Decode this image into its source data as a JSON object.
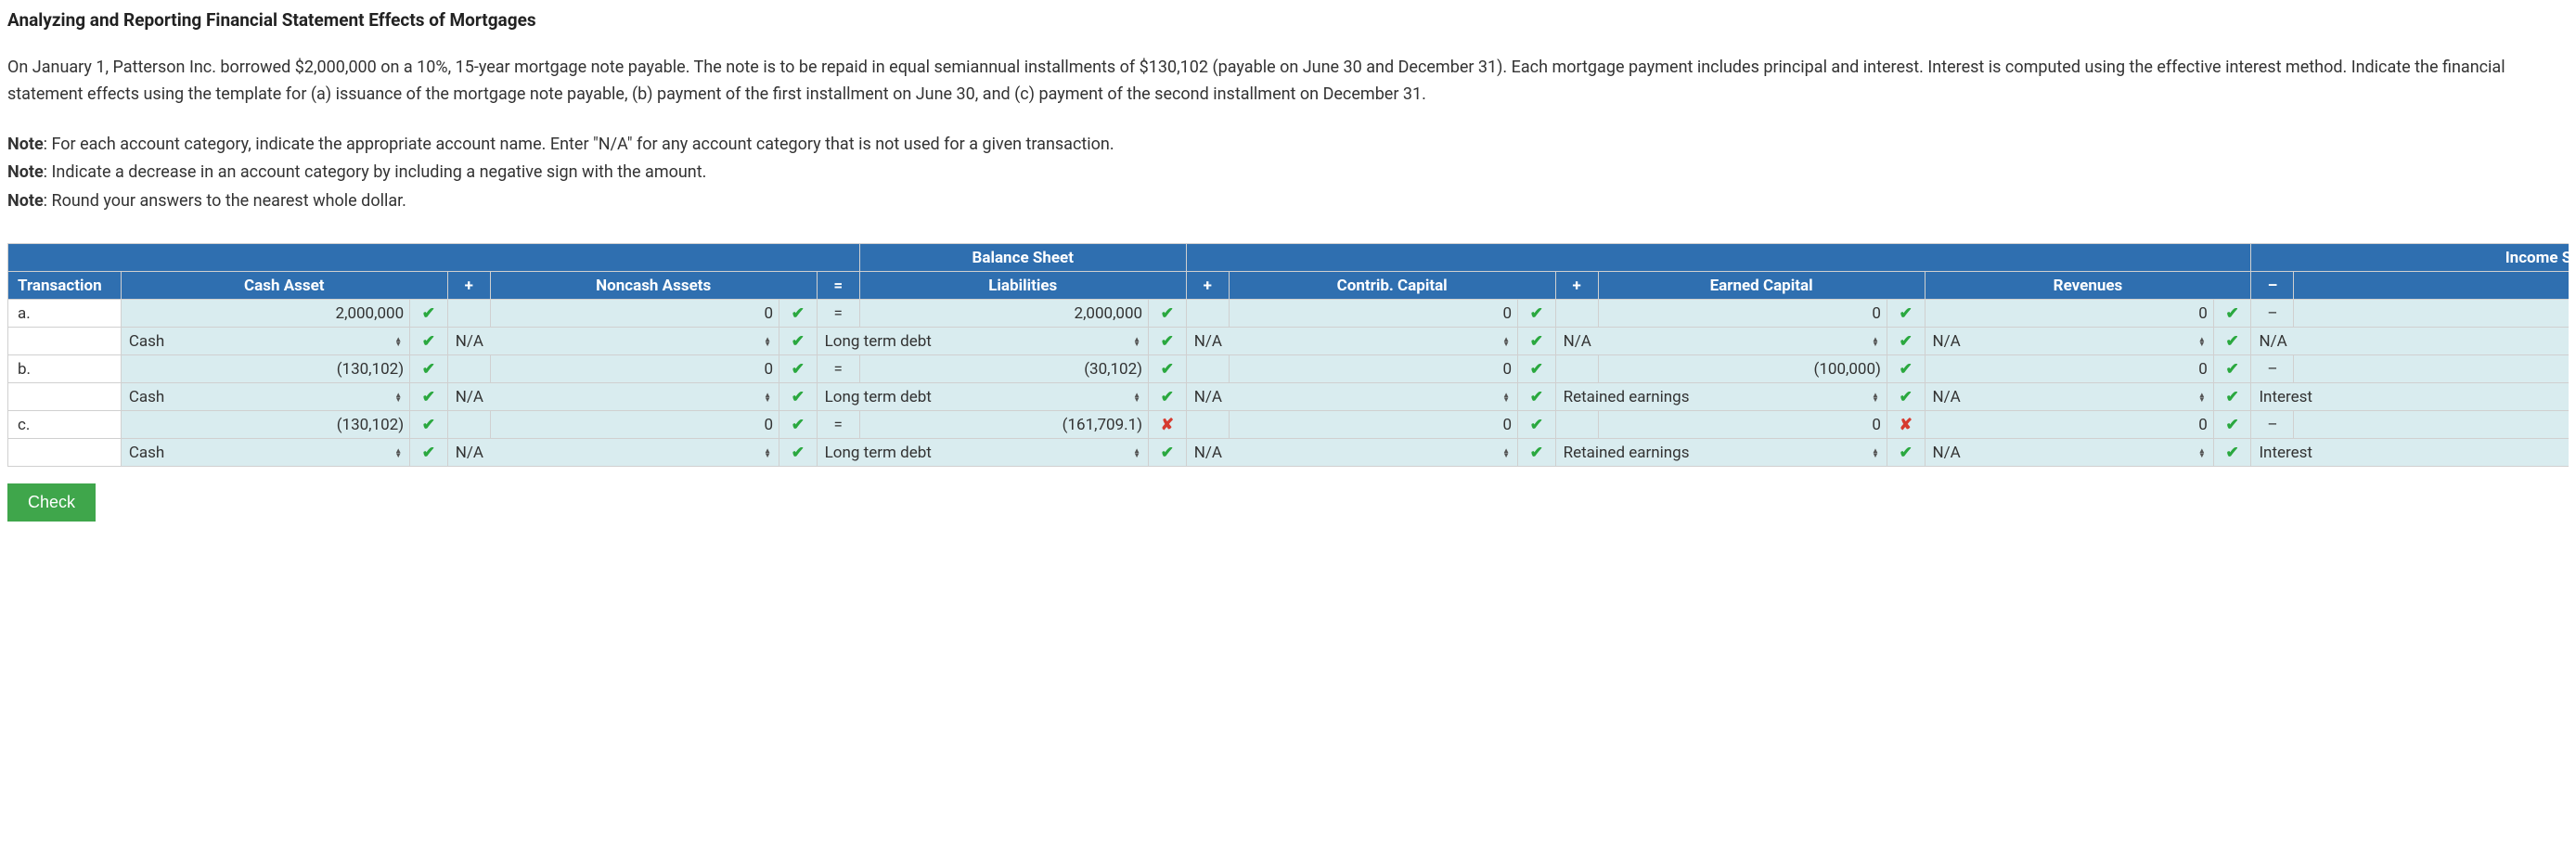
{
  "title": "Analyzing and Reporting Financial Statement Effects of Mortgages",
  "paragraph": "On January 1, Patterson Inc. borrowed $2,000,000 on a 10%, 15-year mortgage note payable. The note is to be repaid in equal semiannual installments of $130,102 (payable on June 30 and December 31). Each mortgage payment includes principal and interest. Interest is computed using the effective interest method. Indicate the financial statement effects using the template for (a) issuance of the mortgage note payable, (b) payment of the first installment on June 30, and (c) payment of the second installment on December 31.",
  "notes": {
    "label": "Note",
    "n1": ": For each account category, indicate the appropriate account name. Enter \"N/A\" for any account category that is not used for a given transaction.",
    "n2": ": Indicate a decrease in an account category by including a negative sign with the amount.",
    "n3": ": Round your answers to the nearest whole dollar."
  },
  "headers": {
    "balance_sheet": "Balance Sheet",
    "income_st": "Income St",
    "transaction": "Transaction",
    "cash_asset": "Cash Asset",
    "plus": "+",
    "noncash_assets": "Noncash Assets",
    "eq": "=",
    "liabilities": "Liabilities",
    "contrib_capital": "Contrib. Capital",
    "earned_capital": "Earned Capital",
    "revenues": "Revenues",
    "minus": "–"
  },
  "marks": {
    "ok": "✔",
    "bad": "✘"
  },
  "rows": {
    "a": {
      "label": "a.",
      "cash_amount": "2,000,000",
      "cash_ok": true,
      "noncash_amount": "0",
      "noncash_ok": true,
      "eq": "=",
      "liab_amount": "2,000,000",
      "liab_ok": true,
      "cc_amount": "0",
      "cc_ok": true,
      "ec_amount": "0",
      "ec_ok": true,
      "rev_amount": "0",
      "rev_ok": true,
      "minus": "–",
      "cash_acct": "Cash",
      "cash_acct_ok": true,
      "noncash_acct": "N/A",
      "noncash_acct_ok": true,
      "liab_acct": "Long term debt",
      "liab_acct_ok": true,
      "cc_acct": "N/A",
      "cc_acct_ok": true,
      "ec_acct": "N/A",
      "ec_acct_ok": true,
      "rev_acct": "N/A",
      "rev_acct_ok": true,
      "exp_acct": "N/A"
    },
    "b": {
      "label": "b.",
      "cash_amount": "(130,102)",
      "cash_ok": true,
      "noncash_amount": "0",
      "noncash_ok": true,
      "eq": "=",
      "liab_amount": "(30,102)",
      "liab_ok": true,
      "cc_amount": "0",
      "cc_ok": true,
      "ec_amount": "(100,000)",
      "ec_ok": true,
      "rev_amount": "0",
      "rev_ok": true,
      "minus": "–",
      "cash_acct": "Cash",
      "cash_acct_ok": true,
      "noncash_acct": "N/A",
      "noncash_acct_ok": true,
      "liab_acct": "Long term debt",
      "liab_acct_ok": true,
      "cc_acct": "N/A",
      "cc_acct_ok": true,
      "ec_acct": "Retained earnings",
      "ec_acct_ok": true,
      "rev_acct": "N/A",
      "rev_acct_ok": true,
      "exp_acct": "Interest"
    },
    "c": {
      "label": "c.",
      "cash_amount": "(130,102)",
      "cash_ok": true,
      "noncash_amount": "0",
      "noncash_ok": true,
      "eq": "=",
      "liab_amount": "(161,709.1)",
      "liab_ok": false,
      "cc_amount": "0",
      "cc_ok": true,
      "ec_amount": "0",
      "ec_ok": false,
      "rev_amount": "0",
      "rev_ok": true,
      "minus": "–",
      "cash_acct": "Cash",
      "cash_acct_ok": true,
      "noncash_acct": "N/A",
      "noncash_acct_ok": true,
      "liab_acct": "Long term debt",
      "liab_acct_ok": true,
      "cc_acct": "N/A",
      "cc_acct_ok": true,
      "ec_acct": "Retained earnings",
      "ec_acct_ok": true,
      "rev_acct": "N/A",
      "rev_acct_ok": true,
      "exp_acct": "Interest"
    }
  },
  "button_check": "Check"
}
